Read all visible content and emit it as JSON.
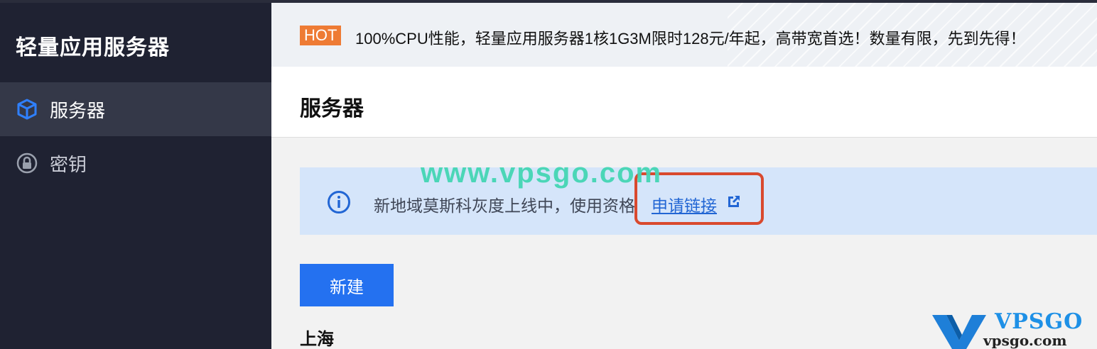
{
  "sidebar": {
    "title": "轻量应用服务器",
    "items": [
      {
        "label": "服务器",
        "icon": "cube-icon",
        "active": true
      },
      {
        "label": "密钥",
        "icon": "key-lock-icon",
        "active": false
      }
    ]
  },
  "promo": {
    "badge": "HOT",
    "text": "100%CPU性能，轻量应用服务器1核1G3M限时128元/年起，高带宽首选！数量有限，先到先得！"
  },
  "header": {
    "title": "服务器"
  },
  "notice": {
    "text": "新地域莫斯科灰度上线中，使用资格",
    "link_label": "申请链接"
  },
  "watermark": "www.vpsgo.com",
  "actions": {
    "new_label": "新建"
  },
  "region": {
    "label": "上海"
  },
  "logo": {
    "top": "VPSGO",
    "bottom": "vpsgo.com"
  },
  "colors": {
    "sidebar_bg": "#1f2232",
    "accent": "#2471f0",
    "hot": "#ee7b34",
    "notice_bg": "#d5e5fa",
    "highlight": "#d9492e"
  }
}
